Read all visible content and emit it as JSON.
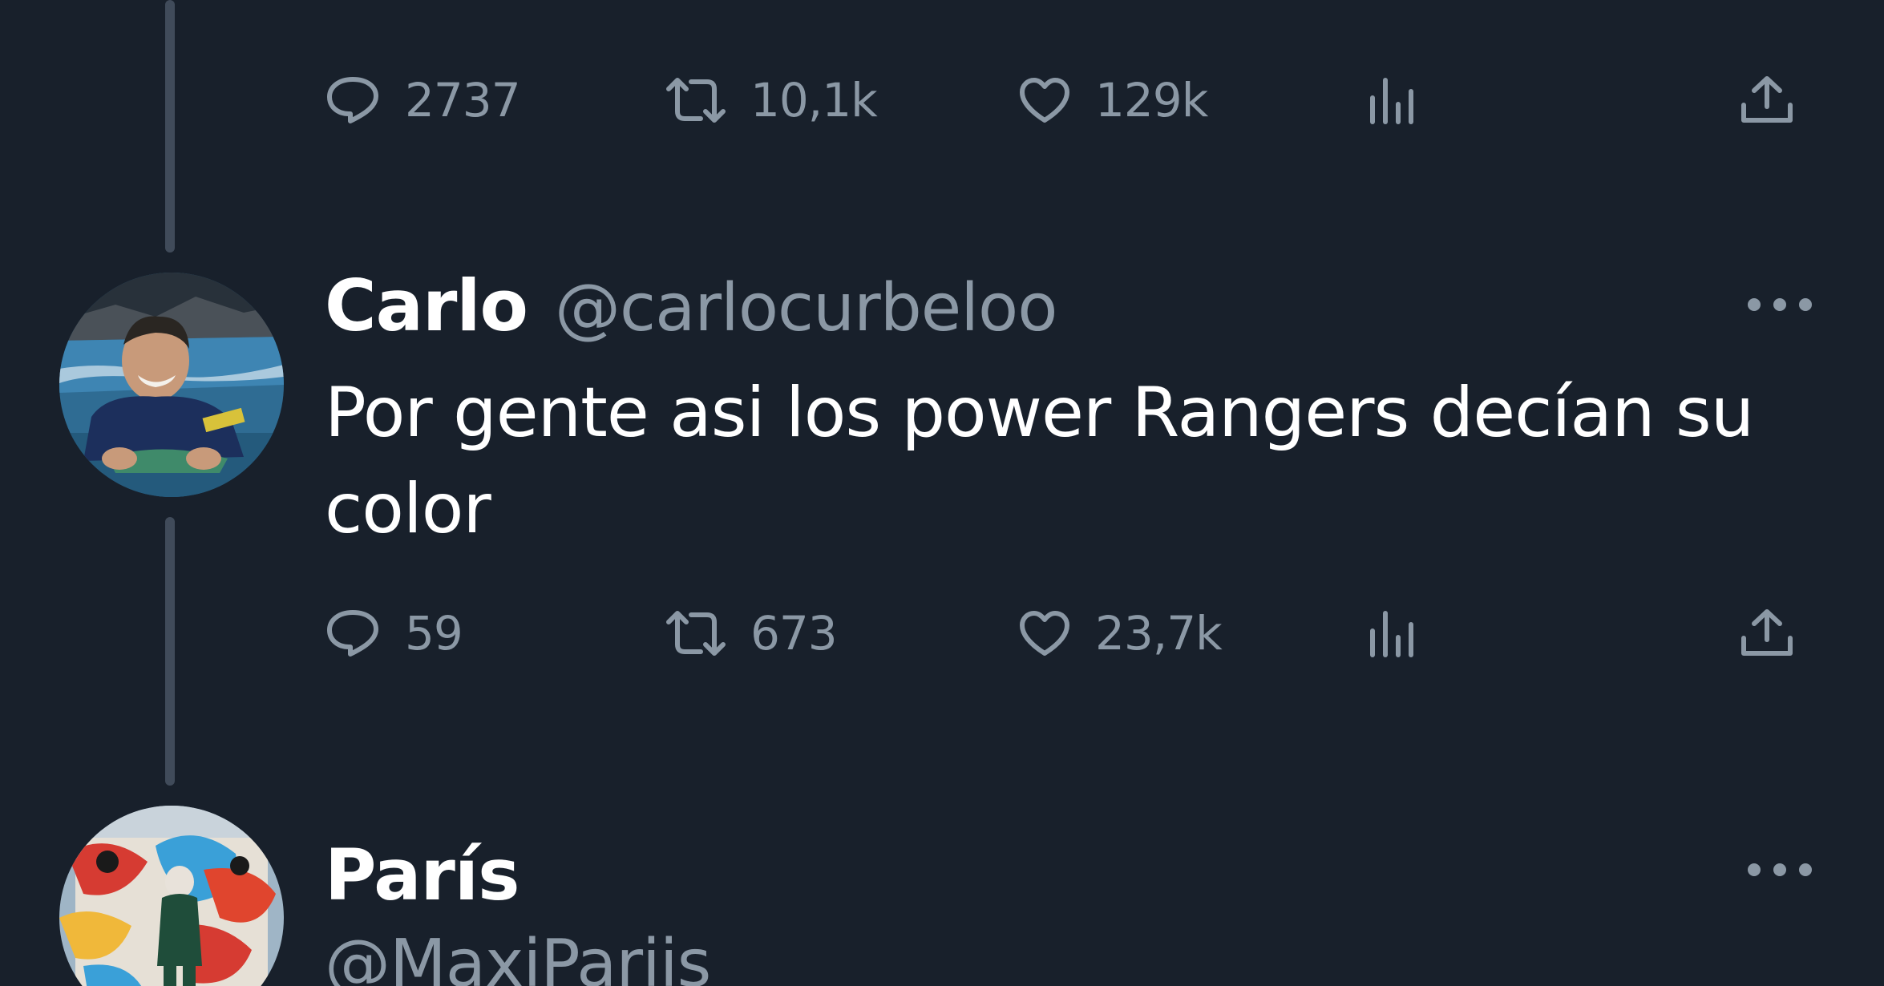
{
  "top_tweet": {
    "partial_text": "··············",
    "metrics": {
      "replies": "2737",
      "retweets": "10,1k",
      "likes": "129k"
    }
  },
  "reply_1": {
    "display_name": "Carlo",
    "handle": "@carlocurbeloo",
    "text": "Por gente asi los power Rangers decían su color",
    "metrics": {
      "replies": "59",
      "retweets": "673",
      "likes": "23,7k"
    }
  },
  "reply_2": {
    "display_name": "París",
    "handle": "@MaxiPariis"
  },
  "icons": {
    "reply": "speech-bubble-icon",
    "retweet": "retweet-arrows-icon",
    "like": "heart-icon",
    "views": "bar-chart-icon",
    "share": "share-upload-icon",
    "more": "ellipsis-icon"
  },
  "colors": {
    "background": "#18202b",
    "text_primary": "#ffffff",
    "text_secondary": "#8b98a5",
    "thread_line": "#404b5a"
  }
}
